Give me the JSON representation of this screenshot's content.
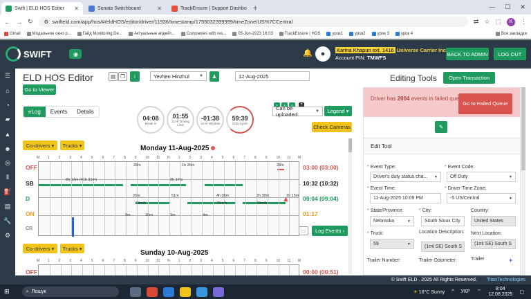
{
  "browser": {
    "tabs": [
      {
        "title": "Swift | ELD HOS Editor",
        "color": "#1f9b60",
        "active": true
      },
      {
        "title": "Sonata Switchboard",
        "color": "#4a7bd0",
        "active": false
      },
      {
        "title": "TrackEnsure | Support Dashbo",
        "color": "#e74c3c",
        "active": false
      }
    ],
    "url": "swifteld.com/app/hos/#/eldHOS/editor/driver/11936/timestamp/1755032399999/timeZone/US%7CCentral",
    "profile_initial": "K",
    "bookmarks": [
      "Gmail",
      "Модальное окно р...",
      "Гайд Monitoring De...",
      "Актуальные апдейт...",
      "Companies with res...",
      "05-Jun-2023 16:03",
      "TrackEnsure | HOS",
      "урок1",
      "урок2",
      "урок 3",
      "урок 4",
      "Все закладки"
    ]
  },
  "header": {
    "logo_text": "SWIFT",
    "user_name": "Karina Khapun ext. 1416",
    "carrier": "Universe Carrier Inc",
    "pin_label": "Account PIN:",
    "pin": "TMWFS",
    "back_admin": "BACK TO ADMIN",
    "logout": "LOG OUT"
  },
  "editor": {
    "title": "ELD HOS Editor",
    "go_viewer": "Go to Viewer",
    "driver": "Yevhen Hinzhul",
    "date": "12-Aug-2025",
    "tabs": [
      "eLog",
      "Events",
      "Details"
    ],
    "gauges": [
      {
        "value": "04:08",
        "label": "Break In",
        "red": false
      },
      {
        "value": "01:55",
        "label": "11 Hr Driving Limit",
        "red": false
      },
      {
        "value": "-01:38",
        "label": "14 Hr Window",
        "red": false
      },
      {
        "value": "59:39",
        "label": "Duty Cycle",
        "red": true
      }
    ],
    "upload_select": "Can be uploaded:",
    "legend": "Legend",
    "check_cameras": "Check Cameras",
    "codrivers": "Co-drivers",
    "trucks": "Trucks",
    "day1_title": "Monday 11-Aug-2025",
    "day2_title": "Sunday 10-Aug-2025",
    "rows": [
      "OFF",
      "SB",
      "D",
      "ON"
    ],
    "totals": [
      "03:00 (03:00)",
      "10:32 (10:32)",
      "09:04 (09:04)",
      "01:17"
    ],
    "cr_label": "CR",
    "hour_ticks": [
      "M",
      "1",
      "2",
      "3",
      "4",
      "5",
      "6",
      "7",
      "8",
      "9",
      "10",
      "11",
      "N",
      "1",
      "2",
      "3",
      "4",
      "5",
      "6",
      "7",
      "8",
      "9",
      "10",
      "11",
      "M"
    ],
    "segment_labels": [
      "8h 14m (41h 31m)",
      "28m",
      "1h 26m",
      "2h 17m",
      "26m",
      "51m",
      "4h 06m",
      "70m/h",
      "2h 38m",
      "69m/h",
      "28m",
      "1h 15m",
      "60m/h",
      "9m",
      "10m",
      "3m",
      "4m"
    ],
    "log_events": "Log Events",
    "day2_total_partial": "00:00 (00:51)"
  },
  "tools": {
    "title": "Editing Tools",
    "open_transaction": "Open Transaction",
    "alert_pre": "Driver has",
    "alert_count": "2004",
    "alert_post": "events in failed queue!",
    "failed_queue_btn": "Go to Failed Queue",
    "edit_tool": "Edit Tool",
    "fields": {
      "event_type": {
        "label": "Event Type:",
        "value": "Driver's duty status cha..."
      },
      "event_code": {
        "label": "Event Code:",
        "value": "Off Duty"
      },
      "event_time": {
        "label": "Event Time:",
        "value": "11-Aug-2025 10:09 PM"
      },
      "driver_tz": {
        "label": "Driver Time Zone:",
        "value": "-5 US/Central"
      },
      "state": {
        "label": "State/Province:",
        "value": "Nebraska"
      },
      "city": {
        "label": "City:",
        "value": "South Sioux City"
      },
      "country": {
        "label": "Country:",
        "value": "United States"
      },
      "truck": {
        "label": "Truck:",
        "value": "59"
      },
      "location_desc": {
        "label": "Location Description:",
        "value": "(1ml SE) South S"
      },
      "next_location": {
        "label": "Next Location:",
        "value": "(1ml SE) South S"
      },
      "trailer_number": {
        "label": "Trailer Number:",
        "value": ""
      },
      "trailer_odometer": {
        "label": "Trailer Odometer:",
        "value": ""
      },
      "trailer": {
        "label": "Trailer",
        "value": ""
      }
    }
  },
  "footer": {
    "copyright": "© Swift ELD . 2025 All Rights Reserved.",
    "powered": "TitanTechnologies"
  },
  "taskbar": {
    "search": "Пошук",
    "weather": "16°C Sunny",
    "lang": "УКР",
    "time": "8:04",
    "date": "12.08.2025"
  }
}
